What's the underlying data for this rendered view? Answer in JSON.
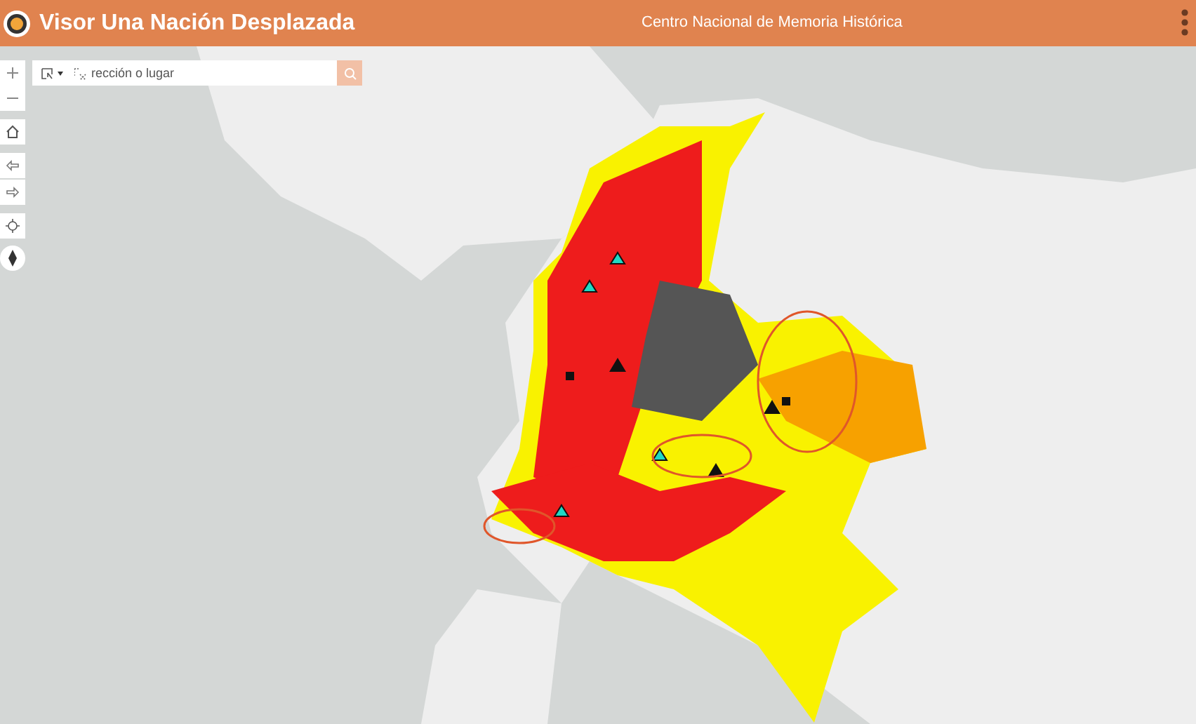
{
  "header": {
    "title": "Visor Una Nación Desplazada",
    "subtitle": "Centro Nacional de Memoria Histórica"
  },
  "search": {
    "placeholder": "rección o lugar"
  }
}
